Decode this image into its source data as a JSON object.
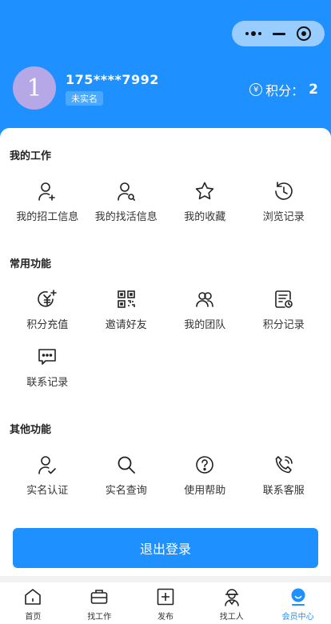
{
  "user": {
    "avatar_letter": "1",
    "phone": "175****7992",
    "verify_badge": "未实名"
  },
  "points": {
    "label": "积分：",
    "value": "2",
    "coin_glyph": "¥"
  },
  "sections": [
    {
      "title": "我的工作",
      "items": [
        {
          "label": "我的招工信息",
          "icon": "user-add-icon"
        },
        {
          "label": "我的找活信息",
          "icon": "user-search-icon"
        },
        {
          "label": "我的收藏",
          "icon": "star-icon"
        },
        {
          "label": "浏览记录",
          "icon": "history-icon"
        }
      ]
    },
    {
      "title": "常用功能",
      "items": [
        {
          "label": "积分充值",
          "icon": "coin-plus-icon"
        },
        {
          "label": "邀请好友",
          "icon": "qrcode-icon"
        },
        {
          "label": "我的团队",
          "icon": "team-icon"
        },
        {
          "label": "积分记录",
          "icon": "record-icon"
        },
        {
          "label": "联系记录",
          "icon": "chat-icon"
        }
      ]
    },
    {
      "title": "其他功能",
      "items": [
        {
          "label": "实名认证",
          "icon": "user-verify-icon"
        },
        {
          "label": "实名查询",
          "icon": "search-icon"
        },
        {
          "label": "使用帮助",
          "icon": "help-icon"
        },
        {
          "label": "联系客服",
          "icon": "phone-icon"
        }
      ]
    }
  ],
  "logout_label": "退出登录",
  "tabs": [
    {
      "label": "首页",
      "icon": "home-icon"
    },
    {
      "label": "找工作",
      "icon": "briefcase-icon"
    },
    {
      "label": "发布",
      "icon": "plus-square-icon"
    },
    {
      "label": "找工人",
      "icon": "worker-icon"
    },
    {
      "label": "会员中心",
      "icon": "member-icon"
    }
  ],
  "colors": {
    "primary": "#1e90ff",
    "avatar": "#b6a7e6"
  }
}
